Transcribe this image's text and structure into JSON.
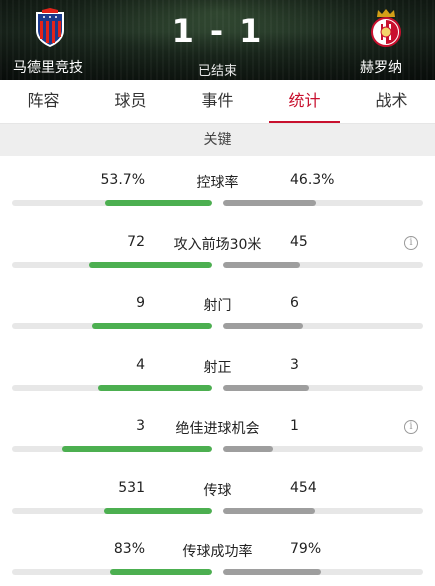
{
  "match": {
    "home_team": "马德里竞技",
    "away_team": "赫罗纳",
    "home_score": "1",
    "away_score": "1",
    "separator": "-",
    "status": "已结束"
  },
  "tabs": [
    {
      "label": "阵容",
      "active": false
    },
    {
      "label": "球员",
      "active": false
    },
    {
      "label": "事件",
      "active": false
    },
    {
      "label": "统计",
      "active": true
    },
    {
      "label": "战术",
      "active": false
    }
  ],
  "section": {
    "title": "关键"
  },
  "colors": {
    "accent": "#c8102e",
    "home_bar": "#4caf50",
    "away_bar": "#9e9e9e"
  },
  "stats": [
    {
      "label": "控球率",
      "home": "53.7%",
      "away": "46.3%",
      "home_ratio": 0.537,
      "away_ratio": 0.463,
      "info": false
    },
    {
      "label": "攻入前场30米",
      "home": "72",
      "away": "45",
      "home_ratio": 0.615,
      "away_ratio": 0.385,
      "info": true
    },
    {
      "label": "射门",
      "home": "9",
      "away": "6",
      "home_ratio": 0.6,
      "away_ratio": 0.4,
      "info": false
    },
    {
      "label": "射正",
      "home": "4",
      "away": "3",
      "home_ratio": 0.571,
      "away_ratio": 0.429,
      "info": false
    },
    {
      "label": "绝佳进球机会",
      "home": "3",
      "away": "1",
      "home_ratio": 0.75,
      "away_ratio": 0.25,
      "info": true
    },
    {
      "label": "传球",
      "home": "531",
      "away": "454",
      "home_ratio": 0.539,
      "away_ratio": 0.461,
      "info": false
    },
    {
      "label": "传球成功率",
      "home": "83%",
      "away": "79%",
      "home_ratio": 0.51,
      "away_ratio": 0.49,
      "info": false
    }
  ]
}
